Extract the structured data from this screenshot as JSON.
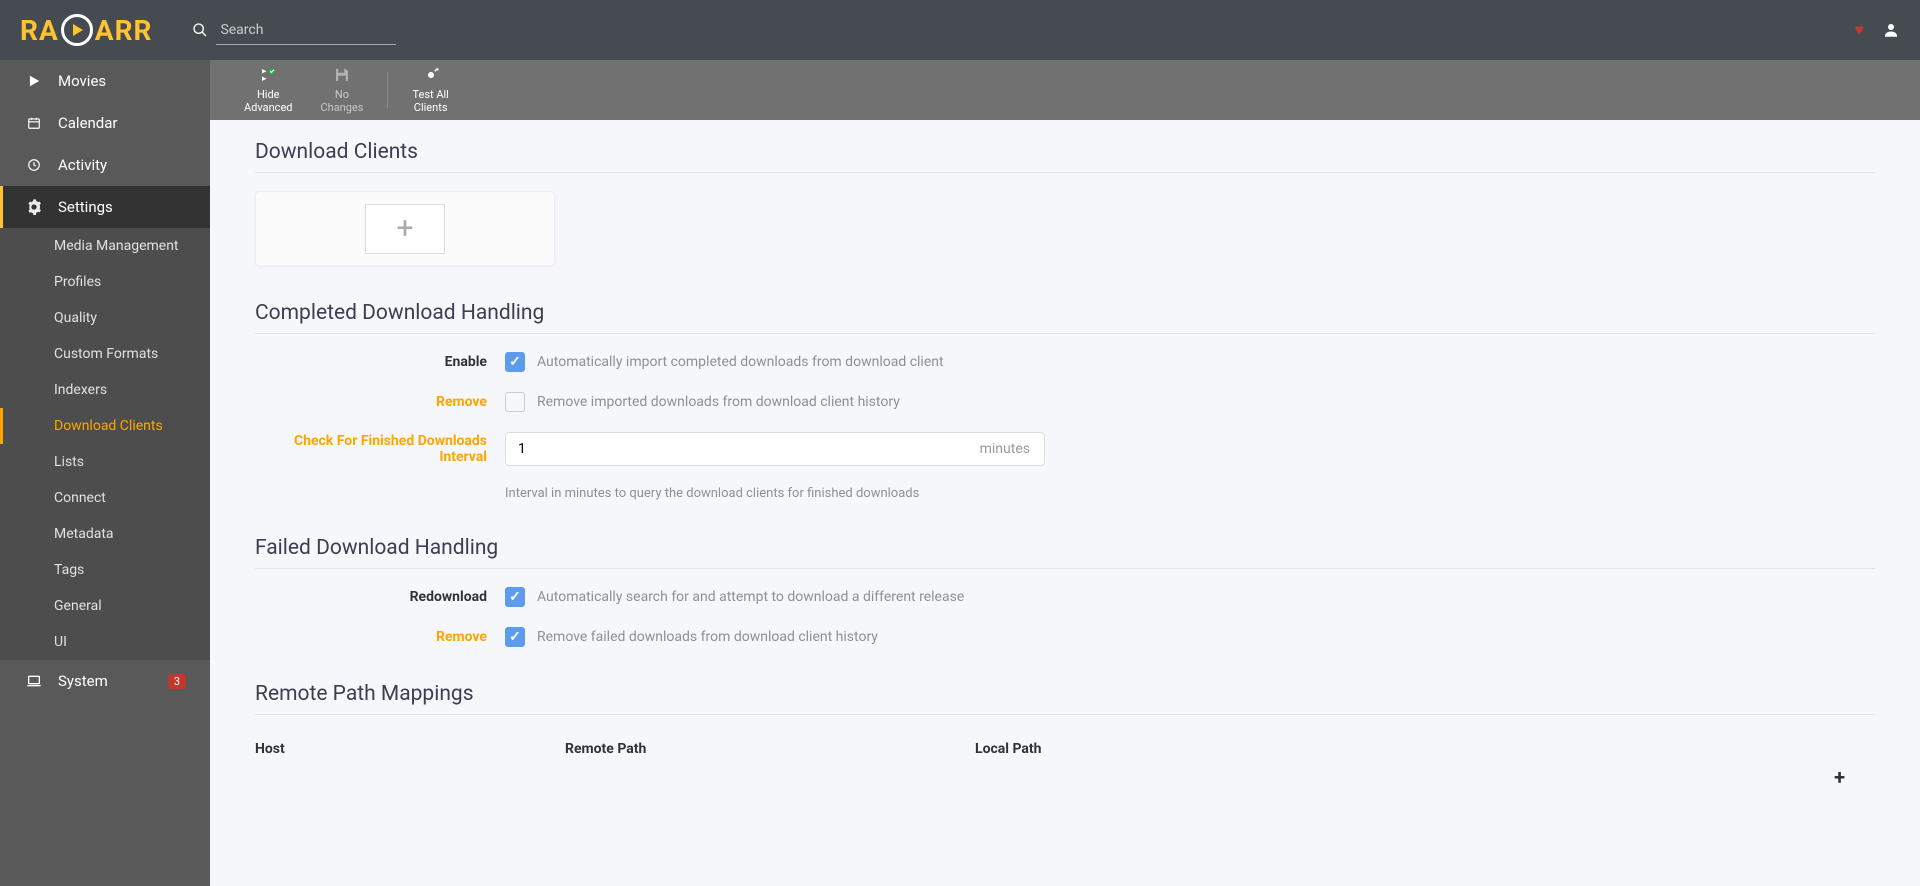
{
  "header": {
    "searchPlaceholder": "Search"
  },
  "sidebar": {
    "movies": "Movies",
    "calendar": "Calendar",
    "activity": "Activity",
    "settings": "Settings",
    "system": "System",
    "systemBadge": "3",
    "sub": {
      "mediaManagement": "Media Management",
      "profiles": "Profiles",
      "quality": "Quality",
      "customFormats": "Custom Formats",
      "indexers": "Indexers",
      "downloadClients": "Download Clients",
      "lists": "Lists",
      "connect": "Connect",
      "metadata": "Metadata",
      "tags": "Tags",
      "general": "General",
      "ui": "UI"
    }
  },
  "toolbar": {
    "hideAdvancedLine1": "Hide",
    "hideAdvancedLine2": "Advanced",
    "noChangesLine1": "No",
    "noChangesLine2": "Changes",
    "testAllLine1": "Test All",
    "testAllLine2": "Clients"
  },
  "sections": {
    "downloadClients": "Download Clients",
    "completedHandling": "Completed Download Handling",
    "failedHandling": "Failed Download Handling",
    "remoteMappings": "Remote Path Mappings"
  },
  "completed": {
    "enableLabel": "Enable",
    "enableHelp": "Automatically import completed downloads from download client",
    "removeLabel": "Remove",
    "removeHelp": "Remove imported downloads from download client history",
    "intervalLabel": "Check For Finished Downloads Interval",
    "intervalValue": "1",
    "intervalSuffix": "minutes",
    "intervalHint": "Interval in minutes to query the download clients for finished downloads"
  },
  "failed": {
    "redownloadLabel": "Redownload",
    "redownloadHelp": "Automatically search for and attempt to download a different release",
    "removeLabel": "Remove",
    "removeHelp": "Remove failed downloads from download client history"
  },
  "mappings": {
    "hostHeader": "Host",
    "remoteHeader": "Remote Path",
    "localHeader": "Local Path"
  }
}
